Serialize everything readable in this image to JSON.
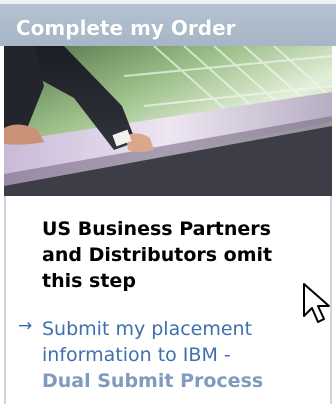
{
  "header": {
    "title": "Complete my Order"
  },
  "hero": {
    "icon": "hero-photo"
  },
  "main": {
    "heading_lines": [
      "US Business Partners",
      "and Distributors omit",
      "this step"
    ],
    "link": {
      "arrow": "→",
      "lines": [
        "Submit my placement",
        "information to IBM -"
      ],
      "subline": "Dual Submit Process"
    }
  },
  "colors": {
    "header_bg": "#a7b6c6",
    "link": "#3f6fae",
    "link_secondary": "#7f9bbd"
  },
  "icons": {
    "cursor": "mouse-pointer-icon",
    "arrow": "arrow-right-icon"
  }
}
